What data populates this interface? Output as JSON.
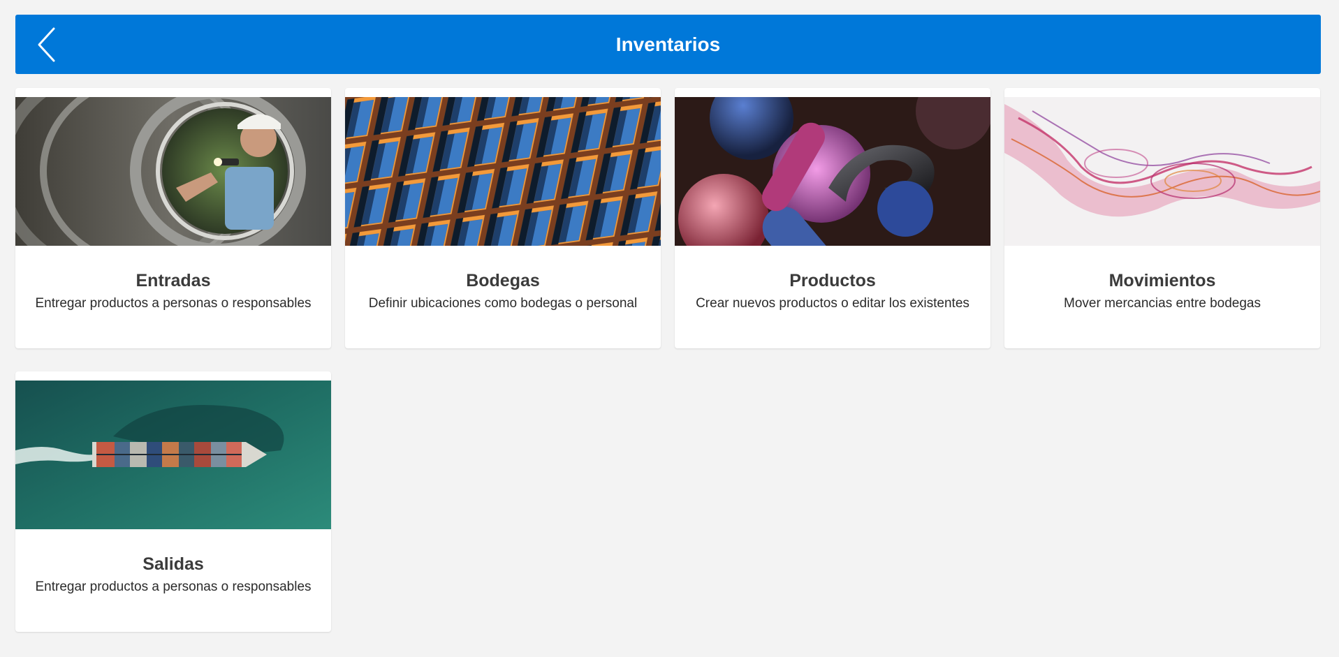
{
  "header": {
    "title": "Inventarios",
    "back_icon": "chevron-left-icon",
    "background_color": "#0078d9"
  },
  "cards": [
    {
      "title": "Entradas",
      "description": "Entregar productos a personas o responsables",
      "image": "pipe-inspector-photo"
    },
    {
      "title": "Bodegas",
      "description": "Definir ubicaciones como bodegas o personal",
      "image": "building-facade-photo"
    },
    {
      "title": "Productos",
      "description": "Crear nuevos productos o editar los existentes",
      "image": "abstract-3d-shapes-photo"
    },
    {
      "title": "Movimientos",
      "description": "Mover mercancias entre bodegas",
      "image": "abstract-fluid-art-photo"
    },
    {
      "title": "Salidas",
      "description": "Entregar productos a personas o responsables",
      "image": "cargo-ship-aerial-photo"
    }
  ]
}
